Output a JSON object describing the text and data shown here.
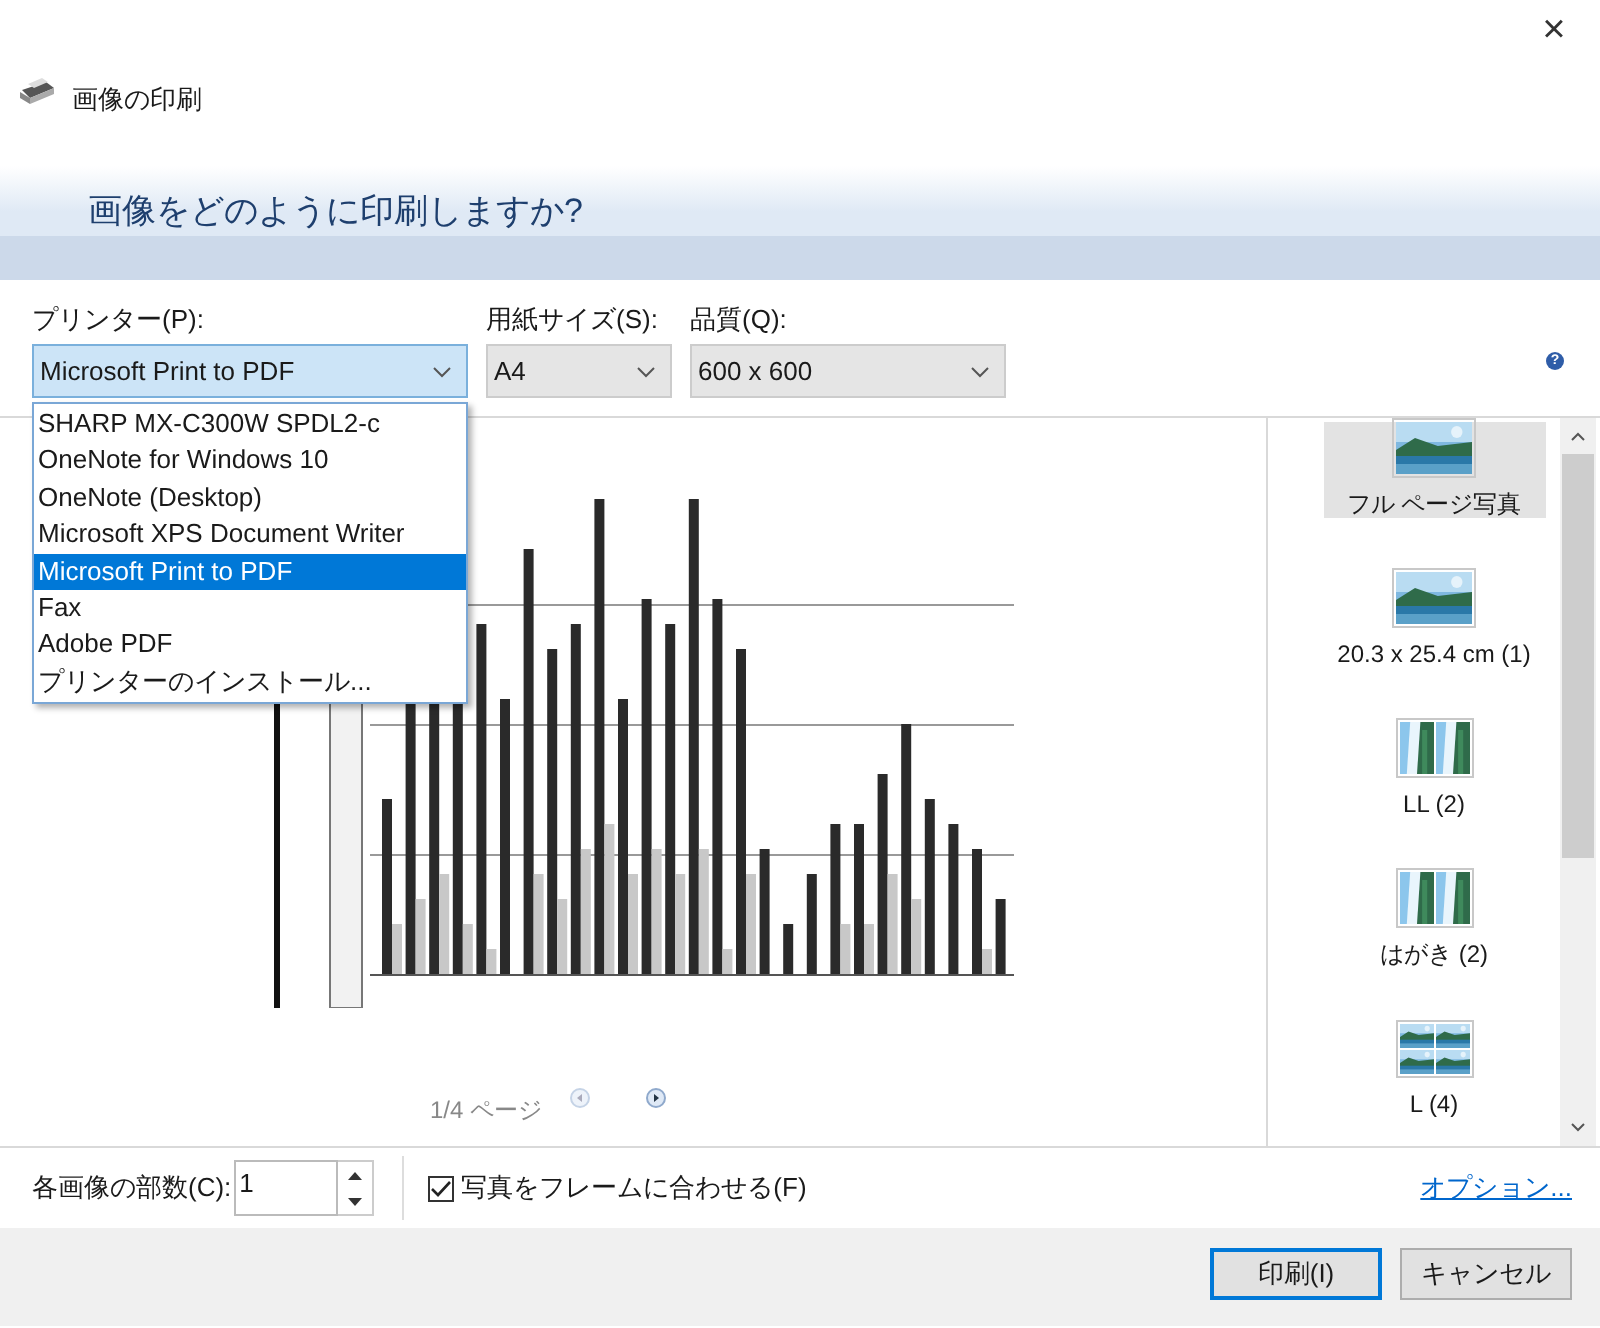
{
  "window": {
    "close": "×",
    "title": "画像の印刷"
  },
  "header": {
    "question": "画像をどのように印刷しますか?"
  },
  "help": "?",
  "selects": [
    {
      "label": "プリンター(P):",
      "value": "Microsoft Print to PDF",
      "focused": true
    },
    {
      "label": "用紙サイズ(S):",
      "value": "A4",
      "focused": false
    },
    {
      "label": "品質(Q):",
      "value": "600 x 600",
      "focused": false
    }
  ],
  "printer_dropdown": [
    {
      "label": "SHARP MX-C300W SPDL2-c",
      "selected": false
    },
    {
      "label": "OneNote for Windows 10",
      "selected": false
    },
    {
      "label": "OneNote (Desktop)",
      "selected": false
    },
    {
      "label": "Microsoft XPS Document Writer",
      "selected": false
    },
    {
      "label": "Microsoft Print to PDF",
      "selected": true
    },
    {
      "label": "Fax",
      "selected": false
    },
    {
      "label": "Adobe PDF",
      "selected": false
    },
    {
      "label": "プリンターのインストール...",
      "selected": false
    }
  ],
  "preview": {
    "kind": "picture",
    "page": "1/4 ページ"
  },
  "layouts": [
    {
      "label": "フル ページ写真",
      "kind": "one",
      "selected": true
    },
    {
      "label": "20.3 x 25.4 cm (1)",
      "kind": "one",
      "selected": false
    },
    {
      "label": "LL (2)",
      "kind": "two",
      "selected": false
    },
    {
      "label": "はがき (2)",
      "kind": "two",
      "selected": false
    },
    {
      "label": "L (4)",
      "kind": "four",
      "selected": false
    }
  ],
  "copies": {
    "label": "各画像の部数(C):",
    "value": "1"
  },
  "fit": {
    "label": "写真をフレームに合わせる(F)",
    "checked": true
  },
  "options_link": "オプション...",
  "buttons": [
    {
      "label": "印刷(I)",
      "default": true
    },
    {
      "label": "キャンセル",
      "default": false
    }
  ]
}
